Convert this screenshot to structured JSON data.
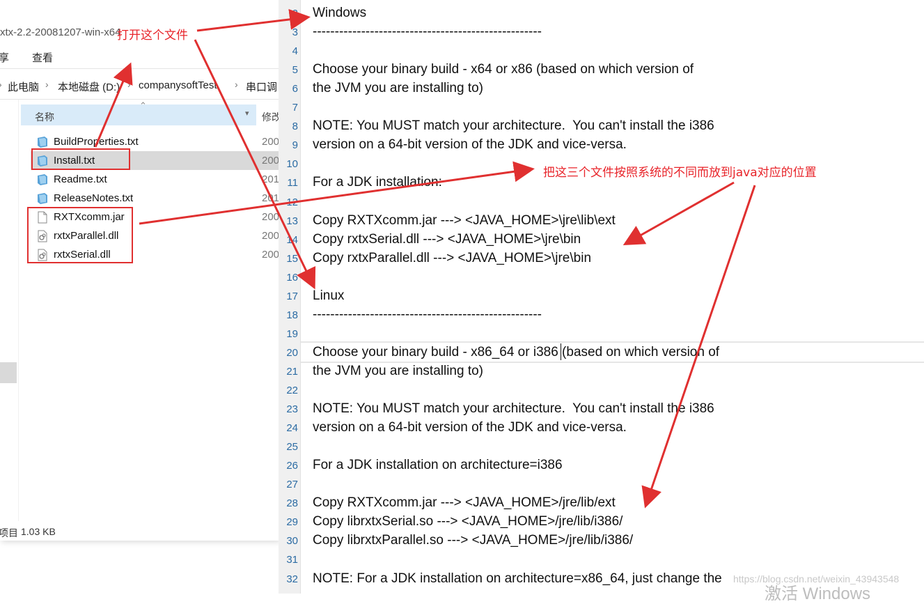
{
  "explorer": {
    "title": "xtx-2.2-20081207-win-x64",
    "ribbon": {
      "tab_share": "享",
      "tab_view": "查看"
    },
    "breadcrumb": [
      "此电脑",
      "本地磁盘 (D:)",
      "companysoftTest",
      "串口调"
    ],
    "columns": {
      "name": "名称",
      "modified": "修改"
    },
    "files": [
      {
        "name": "BuildProperties.txt",
        "date": "200",
        "icon": "text-file-icon"
      },
      {
        "name": "Install.txt",
        "date": "200",
        "icon": "text-file-icon",
        "selected": true
      },
      {
        "name": "Readme.txt",
        "date": "201",
        "icon": "text-file-icon"
      },
      {
        "name": "ReleaseNotes.txt",
        "date": "201",
        "icon": "text-file-icon"
      },
      {
        "name": "RXTXcomm.jar",
        "date": "200",
        "icon": "jar-file-icon"
      },
      {
        "name": "rxtxParallel.dll",
        "date": "200",
        "icon": "dll-file-icon"
      },
      {
        "name": "rxtxSerial.dll",
        "date": "200",
        "icon": "dll-file-icon"
      }
    ],
    "status": {
      "count_label": "项目",
      "size": "1.03 KB"
    }
  },
  "editor": {
    "lines": [
      {
        "n": "2",
        "text": "Windows"
      },
      {
        "n": "3",
        "text": "----------------------------------------------------"
      },
      {
        "n": "4",
        "text": ""
      },
      {
        "n": "5",
        "text": "Choose your binary build - x64 or x86 (based on which version of"
      },
      {
        "n": "6",
        "text": "the JVM you are installing to)"
      },
      {
        "n": "7",
        "text": ""
      },
      {
        "n": "8",
        "text": "NOTE: You MUST match your architecture.  You can't install the i386"
      },
      {
        "n": "9",
        "text": "version on a 64-bit version of the JDK and vice-versa."
      },
      {
        "n": "10",
        "text": ""
      },
      {
        "n": "11",
        "text": "For a JDK installation:"
      },
      {
        "n": "12",
        "text": ""
      },
      {
        "n": "13",
        "text": "Copy RXTXcomm.jar ---> <JAVA_HOME>\\jre\\lib\\ext"
      },
      {
        "n": "14",
        "text": "Copy rxtxSerial.dll ---> <JAVA_HOME>\\jre\\bin"
      },
      {
        "n": "15",
        "text": "Copy rxtxParallel.dll ---> <JAVA_HOME>\\jre\\bin"
      },
      {
        "n": "16",
        "text": ""
      },
      {
        "n": "17",
        "text": "Linux"
      },
      {
        "n": "18",
        "text": "----------------------------------------------------"
      },
      {
        "n": "19",
        "text": ""
      },
      {
        "n": "20",
        "text": "Choose your binary build - x86_64 or i386 (based on which version of"
      },
      {
        "n": "21",
        "text": "the JVM you are installing to)"
      },
      {
        "n": "22",
        "text": ""
      },
      {
        "n": "23",
        "text": "NOTE: You MUST match your architecture.  You can't install the i386"
      },
      {
        "n": "24",
        "text": "version on a 64-bit version of the JDK and vice-versa."
      },
      {
        "n": "25",
        "text": ""
      },
      {
        "n": "26",
        "text": "For a JDK installation on architecture=i386"
      },
      {
        "n": "27",
        "text": ""
      },
      {
        "n": "28",
        "text": "Copy RXTXcomm.jar ---> <JAVA_HOME>/jre/lib/ext"
      },
      {
        "n": "29",
        "text": "Copy librxtxSerial.so ---> <JAVA_HOME>/jre/lib/i386/"
      },
      {
        "n": "30",
        "text": "Copy librxtxParallel.so ---> <JAVA_HOME>/jre/lib/i386/"
      },
      {
        "n": "31",
        "text": ""
      },
      {
        "n": "32",
        "text": "NOTE: For a JDK installation on architecture=x86_64, just change the"
      }
    ]
  },
  "annotations": {
    "open_file": "打开这个文件",
    "place_files": "把这三个文件按照系统的不同而放到java对应的位置",
    "color": "#e8242a"
  },
  "overlay": {
    "watermark": "https://blog.csdn.net/weixin_43943548",
    "activate": "激活 Windows"
  }
}
